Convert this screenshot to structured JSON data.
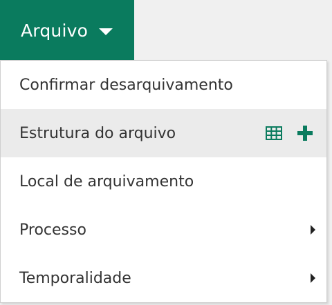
{
  "colors": {
    "accent": "#0a7b5e",
    "menu_bg": "#ffffff",
    "hover_bg": "#ebebeb",
    "text": "#333333"
  },
  "menu_button": {
    "label": "Arquivo",
    "icon": "caret-down-icon"
  },
  "dropdown": {
    "items": [
      {
        "label": "Confirmar desarquivamento"
      },
      {
        "label": "Estrutura do arquivo",
        "highlighted": true,
        "actions": [
          "grid-icon",
          "plus-icon"
        ]
      },
      {
        "label": "Local de arquivamento"
      },
      {
        "label": "Processo",
        "submenu": true
      },
      {
        "label": "Temporalidade",
        "submenu": true
      }
    ]
  }
}
